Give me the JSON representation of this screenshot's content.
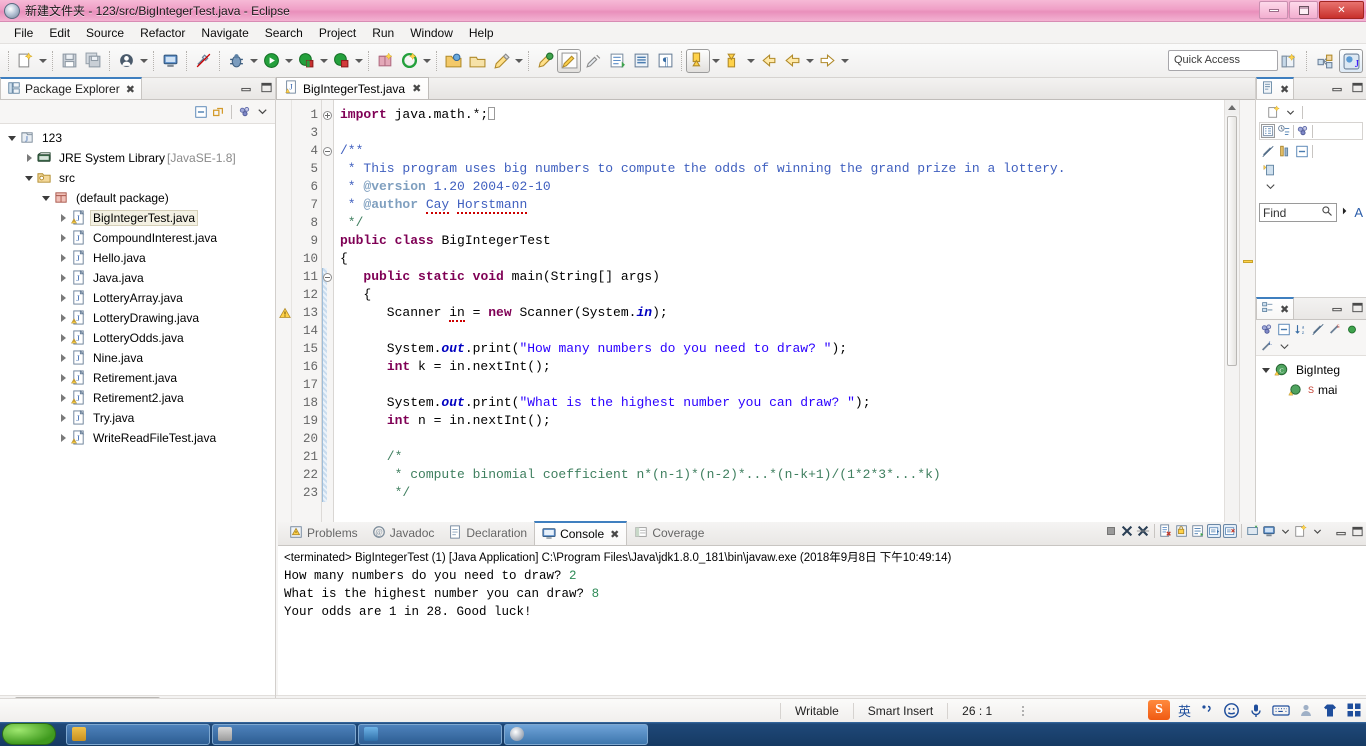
{
  "window": {
    "title": "新建文件夹 - 123/src/BigIntegerTest.java - Eclipse",
    "minimize_label": "–",
    "maximize_label": "❐",
    "close_label": "✕"
  },
  "menubar": {
    "items": [
      "File",
      "Edit",
      "Source",
      "Refactor",
      "Navigate",
      "Search",
      "Project",
      "Run",
      "Window",
      "Help"
    ]
  },
  "toolbar": {
    "quick_access_placeholder": "Quick Access",
    "icons": [
      "new-wizard-icon",
      "save-icon",
      "save-all-icon",
      "new-java-class-icon",
      "print-icon",
      "toggle-mark-occurrences-icon",
      "debug-icon",
      "run-icon",
      "coverage-icon",
      "coverage-last-icon",
      "new-package-icon",
      "external-tools-icon",
      "open-type-icon",
      "open-task-icon",
      "search-icon",
      "last-edit-location-icon",
      "toggle-java-editor-breadcrumb-icon",
      "next-annotation-icon",
      "previous-annotation-icon",
      "back-icon",
      "forward-icon"
    ],
    "perspective_icons": [
      "open-perspective-icon",
      "java-ee-perspective-icon",
      "java-perspective-icon"
    ]
  },
  "package_explorer": {
    "tab_label": "Package Explorer",
    "tab_close": "✖",
    "toolbar_icons": [
      "collapse-all-icon",
      "link-with-editor-icon",
      "view-menu-icon",
      "chevron-down-icon"
    ],
    "minimize_label": "–",
    "maximize_label": "❐",
    "tree": [
      {
        "label": "123",
        "icon": "java-project-icon",
        "indent": 0,
        "state": "open",
        "selected": false
      },
      {
        "label": "JRE System Library",
        "suffix": "[JavaSE-1.8]",
        "icon": "library-icon",
        "indent": 1,
        "state": "closed",
        "selected": false
      },
      {
        "label": "src",
        "icon": "source-folder-icon",
        "indent": 1,
        "state": "open",
        "selected": false
      },
      {
        "label": "(default package)",
        "icon": "package-icon",
        "indent": 2,
        "state": "open",
        "selected": false
      },
      {
        "label": "BigIntegerTest.java",
        "icon": "java-file-warning-icon",
        "indent": 3,
        "state": "closed",
        "selected": true
      },
      {
        "label": "CompoundInterest.java",
        "icon": "java-file-icon",
        "indent": 3,
        "state": "closed",
        "selected": false
      },
      {
        "label": "Hello.java",
        "icon": "java-file-icon",
        "indent": 3,
        "state": "closed",
        "selected": false
      },
      {
        "label": "Java.java",
        "icon": "java-file-icon",
        "indent": 3,
        "state": "closed",
        "selected": false
      },
      {
        "label": "LotteryArray.java",
        "icon": "java-file-icon",
        "indent": 3,
        "state": "closed",
        "selected": false
      },
      {
        "label": "LotteryDrawing.java",
        "icon": "java-file-warning-icon",
        "indent": 3,
        "state": "closed",
        "selected": false
      },
      {
        "label": "LotteryOdds.java",
        "icon": "java-file-warning-icon",
        "indent": 3,
        "state": "closed",
        "selected": false
      },
      {
        "label": "Nine.java",
        "icon": "java-file-icon",
        "indent": 3,
        "state": "closed",
        "selected": false
      },
      {
        "label": "Retirement.java",
        "icon": "java-file-warning-icon",
        "indent": 3,
        "state": "closed",
        "selected": false
      },
      {
        "label": "Retirement2.java",
        "icon": "java-file-warning-icon",
        "indent": 3,
        "state": "closed",
        "selected": false
      },
      {
        "label": "Try.java",
        "icon": "java-file-icon",
        "indent": 3,
        "state": "closed",
        "selected": false
      },
      {
        "label": "WriteReadFileTest.java",
        "icon": "java-file-warning-icon",
        "indent": 3,
        "state": "closed",
        "selected": false
      }
    ]
  },
  "editor": {
    "tab_label": "BigIntegerTest.java",
    "tab_close": "✖",
    "tab_icon": "java-file-warning-icon",
    "minimize_label": "–",
    "maximize_label": "❐",
    "lines": [
      {
        "num": "1",
        "fold": "plus",
        "marker": "",
        "text": "import java.math.*;",
        "caret": true
      },
      {
        "num": "3",
        "fold": "",
        "marker": "",
        "text": ""
      },
      {
        "num": "4",
        "fold": "minus",
        "marker": "",
        "text": "/**"
      },
      {
        "num": "5",
        "fold": "",
        "marker": "",
        "text": " * This program uses big numbers to compute the odds of winning the grand prize in a lottery."
      },
      {
        "num": "6",
        "fold": "",
        "marker": "",
        "text": " * @version 1.20 2004-02-10"
      },
      {
        "num": "7",
        "fold": "",
        "marker": "",
        "text": " * @author Cay Horstmann"
      },
      {
        "num": "8",
        "fold": "",
        "marker": "",
        "text": " */"
      },
      {
        "num": "9",
        "fold": "",
        "marker": "",
        "text": "public class BigIntegerTest"
      },
      {
        "num": "10",
        "fold": "",
        "marker": "",
        "text": "{"
      },
      {
        "num": "11",
        "fold": "minus",
        "marker": "",
        "text": "   public static void main(String[] args)"
      },
      {
        "num": "12",
        "fold": "",
        "marker": "",
        "text": "   {"
      },
      {
        "num": "13",
        "fold": "",
        "marker": "warning",
        "text": "      Scanner in = new Scanner(System.in);"
      },
      {
        "num": "14",
        "fold": "",
        "marker": "",
        "text": ""
      },
      {
        "num": "15",
        "fold": "",
        "marker": "",
        "text": "      System.out.print(\"How many numbers do you need to draw? \");"
      },
      {
        "num": "16",
        "fold": "",
        "marker": "",
        "text": "      int k = in.nextInt();"
      },
      {
        "num": "17",
        "fold": "",
        "marker": "",
        "text": ""
      },
      {
        "num": "18",
        "fold": "",
        "marker": "",
        "text": "      System.out.print(\"What is the highest number you can draw? \");"
      },
      {
        "num": "19",
        "fold": "",
        "marker": "",
        "text": "      int n = in.nextInt();"
      },
      {
        "num": "20",
        "fold": "",
        "marker": "",
        "text": ""
      },
      {
        "num": "21",
        "fold": "",
        "marker": "",
        "text": "      /*"
      },
      {
        "num": "22",
        "fold": "",
        "marker": "",
        "text": "       * compute binomial coefficient n*(n-1)*(n-2)*...*(n-k+1)/(1*2*3*...*k)"
      },
      {
        "num": "23",
        "fold": "",
        "marker": "",
        "text": "       */"
      }
    ]
  },
  "task_list": {
    "tab_icon": "task-list-icon",
    "tab_close": "✖",
    "minimize_label": "–",
    "maximize_label": "❐",
    "find_label": "Find",
    "find_icon": "search-icon",
    "toolbar_icons": [
      "new-task-icon",
      "chevron-down-icon",
      "categorized-presentation-icon",
      "scheduled-presentation-icon",
      "focus-on-workweek-icon",
      "delete-icon",
      "filter-icon",
      "collapse-all-icon",
      "synchronize-icon",
      "view-menu-icon"
    ],
    "sort_icon": "sort-icon",
    "letter": "A"
  },
  "outline": {
    "tab_icon": "outline-icon",
    "tab_close": "✖",
    "minimize_label": "–",
    "maximize_label": "❐",
    "toolbar_icons": [
      "focus-icon",
      "collapse-all-icon",
      "sort-icon",
      "hide-fields-icon",
      "hide-static-icon",
      "hide-nonpublic-icon",
      "hide-local-types-icon",
      "view-menu-icon"
    ],
    "items": [
      {
        "label": "BigInteg",
        "icon": "class-icon",
        "indent": 0,
        "state": "open"
      },
      {
        "label": "mai",
        "icon": "method-static-icon",
        "indent": 1,
        "state": "leaf",
        "badge": "S"
      }
    ]
  },
  "console": {
    "tabs": [
      {
        "label": "Problems",
        "icon": "problems-icon",
        "selected": false
      },
      {
        "label": "Javadoc",
        "icon": "javadoc-icon",
        "selected": false
      },
      {
        "label": "Declaration",
        "icon": "declaration-icon",
        "selected": false
      },
      {
        "label": "Console",
        "icon": "console-icon",
        "selected": true,
        "close": "✖"
      },
      {
        "label": "Coverage",
        "icon": "coverage-icon",
        "selected": false
      }
    ],
    "toolbar_icons": [
      "terminate-icon",
      "remove-launch-icon",
      "remove-all-terminated-icon",
      "clear-console-icon",
      "scroll-lock-icon",
      "word-wrap-icon",
      "show-console-on-output-icon",
      "pin-console-icon",
      "new-console-view-icon",
      "display-selected-console-icon",
      "chevron-down-icon",
      "open-console-icon",
      "chevron-down-icon-2",
      "minimize-icon",
      "maximize-icon"
    ],
    "header": "<terminated> BigIntegerTest (1) [Java Application] C:\\Program Files\\Java\\jdk1.8.0_181\\bin\\javaw.exe (2018年9月8日 下午10:49:14)",
    "output": [
      {
        "prompt": "How many numbers do you need to draw? ",
        "input": "2"
      },
      {
        "prompt": "What is the highest number you can draw? ",
        "input": "8"
      },
      {
        "prompt": "Your odds are 1 in 28. Good luck!",
        "input": ""
      }
    ]
  },
  "statusbar": {
    "writable": "Writable",
    "insert_mode": "Smart Insert",
    "position": "26 : 1"
  },
  "ime": {
    "logo": "S",
    "mode": "英",
    "items": [
      "punctuation-icon",
      "smiley-icon",
      "microphone-icon",
      "soft-keyboard-icon",
      "user-icon",
      "skin-icon",
      "toolbox-icon"
    ]
  },
  "taskbar": {
    "items": [
      "",
      "",
      "",
      ""
    ]
  }
}
